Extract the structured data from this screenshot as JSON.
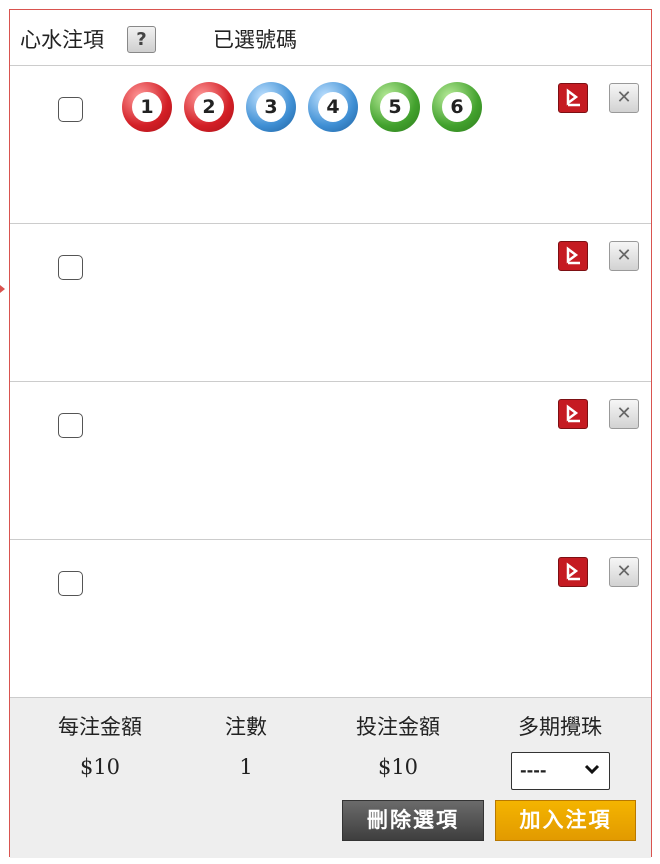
{
  "header": {
    "lucky_label": "心水注項",
    "help_glyph": "?",
    "selected_label": "已選號碼"
  },
  "rows": [
    {
      "balls": [
        {
          "number": "1",
          "color": "red"
        },
        {
          "number": "2",
          "color": "red"
        },
        {
          "number": "3",
          "color": "blue"
        },
        {
          "number": "4",
          "color": "blue"
        },
        {
          "number": "5",
          "color": "green"
        },
        {
          "number": "6",
          "color": "green"
        }
      ]
    },
    {
      "balls": []
    },
    {
      "balls": []
    },
    {
      "balls": []
    }
  ],
  "icons": {
    "download": "download-icon",
    "delete": "close-icon"
  },
  "footer": {
    "unit_amount_label": "每注金額",
    "bets_label": "注數",
    "total_amount_label": "投注金額",
    "multi_draw_label": "多期攪珠",
    "unit_amount_value": "$10",
    "bets_value": "1",
    "total_amount_value": "$10",
    "multi_draw_selected": "----",
    "delete_button": "刪除選項",
    "add_button": "加入注項"
  },
  "colors": {
    "border": "#d9534f",
    "red_ball": "#d31f26",
    "blue_ball": "#3f8fd4",
    "green_ball": "#42a12d",
    "download_icon": "#c51b22",
    "add_button": "#f4b400",
    "delete_button": "#555555"
  }
}
